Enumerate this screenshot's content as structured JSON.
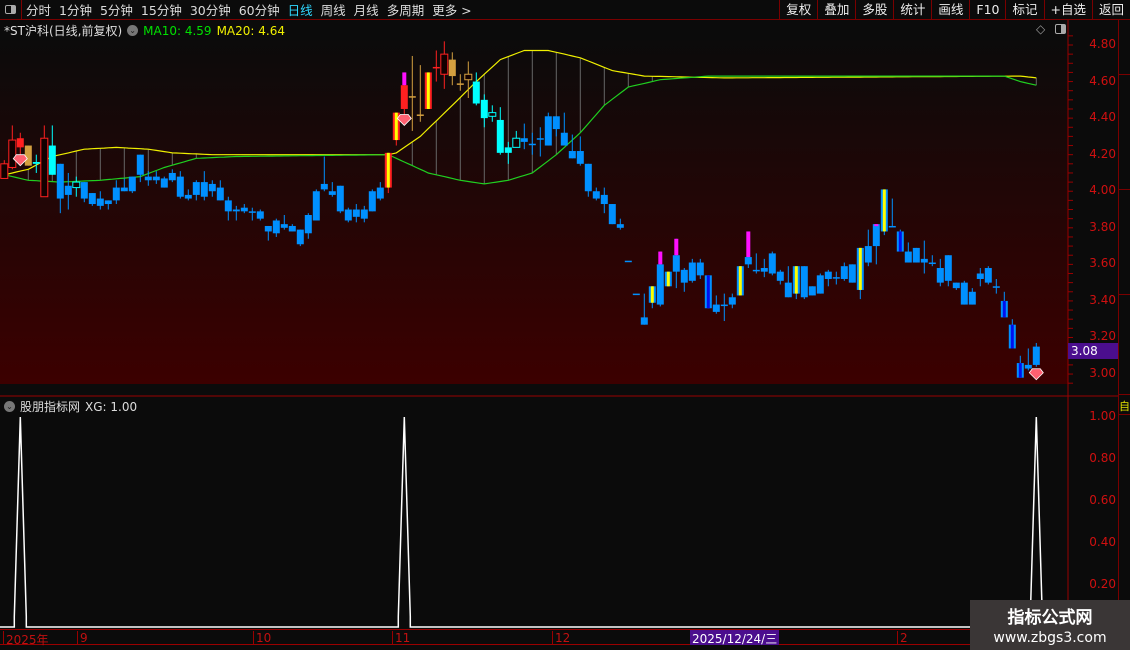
{
  "toolbar": {
    "periods": [
      "分时",
      "1分钟",
      "5分钟",
      "15分钟",
      "30分钟",
      "60分钟",
      "日线",
      "周线",
      "月线",
      "多周期",
      "更多 >"
    ],
    "active": "日线",
    "right_buttons": [
      "复权",
      "叠加",
      "多股",
      "统计",
      "画线",
      "F10",
      "标记",
      "+自选",
      "返回"
    ]
  },
  "title": {
    "stock": "*ST沪科(日线,前复权)",
    "ma10": "MA10: 4.59",
    "ma20": "MA20: 4.64",
    "ma10_color": "#00e000",
    "ma20_color": "#f0f000"
  },
  "price_axis": [
    "4.80",
    "4.60",
    "4.40",
    "4.20",
    "4.00",
    "3.80",
    "3.60",
    "3.40",
    "3.20",
    "3.00"
  ],
  "current_price": "3.08",
  "indicator": {
    "name": "股朋指标网",
    "value": "XG: 1.00",
    "axis": [
      "1.00",
      "0.80",
      "0.60",
      "0.40",
      "0.20"
    ],
    "signal_bars": [
      2,
      50,
      129
    ]
  },
  "time_axis": {
    "labels": [
      "2025年",
      "9",
      "10",
      "11",
      "12",
      "2"
    ],
    "highlight": "2025/12/24/三"
  },
  "right_strip": {
    "label": "自"
  },
  "watermark": {
    "name": "指标公式网",
    "url": "www.zbgs3.com"
  },
  "chart_data": {
    "type": "candlestick",
    "price_range": [
      2.95,
      4.85
    ],
    "candles": [
      [
        4.15,
        4.07,
        4.17,
        4.07,
        "r"
      ],
      [
        4.28,
        4.13,
        4.36,
        4.12,
        "r"
      ],
      [
        4.29,
        4.24,
        4.32,
        4.2,
        "R"
      ],
      [
        4.25,
        4.14,
        4.25,
        4.14,
        "o"
      ],
      [
        4.16,
        4.15,
        4.2,
        4.1,
        "c"
      ],
      [
        4.29,
        3.97,
        4.36,
        3.97,
        "r"
      ],
      [
        4.25,
        4.09,
        4.36,
        4.09,
        "c"
      ],
      [
        4.15,
        3.96,
        4.15,
        3.88,
        "b"
      ],
      [
        4.03,
        3.98,
        4.1,
        3.9,
        "b"
      ],
      [
        4.05,
        4.02,
        4.08,
        3.97,
        "ch"
      ],
      [
        4.05,
        3.96,
        4.05,
        3.94,
        "b"
      ],
      [
        3.99,
        3.93,
        3.99,
        3.92,
        "b"
      ],
      [
        3.96,
        3.92,
        4,
        3.9,
        "b"
      ],
      [
        3.95,
        3.93,
        3.95,
        3.9,
        "b"
      ],
      [
        4.02,
        3.95,
        4.06,
        3.93,
        "b"
      ],
      [
        4.02,
        4,
        4.07,
        4,
        "b"
      ],
      [
        4.08,
        4,
        4.08,
        3.99,
        "b"
      ],
      [
        4.2,
        4.09,
        4.2,
        4.05,
        "b"
      ],
      [
        4.08,
        4.06,
        4.11,
        4.03,
        "b"
      ],
      [
        4.08,
        4.06,
        4.11,
        4.04,
        "b"
      ],
      [
        4.07,
        4.02,
        4.08,
        4.02,
        "b"
      ],
      [
        4.1,
        4.06,
        4.12,
        4.05,
        "b"
      ],
      [
        4.08,
        3.97,
        4.11,
        3.96,
        "b"
      ],
      [
        3.98,
        3.96,
        4.01,
        3.95,
        "b"
      ],
      [
        4.05,
        3.98,
        4.06,
        3.95,
        "b"
      ],
      [
        4.05,
        3.97,
        4.11,
        3.95,
        "b"
      ],
      [
        4.04,
        4,
        4.06,
        3.97,
        "b"
      ],
      [
        4.02,
        3.95,
        4.06,
        3.95,
        "b"
      ],
      [
        3.95,
        3.89,
        3.97,
        3.84,
        "b"
      ],
      [
        3.9,
        3.89,
        3.92,
        3.84,
        "b"
      ],
      [
        3.91,
        3.89,
        3.93,
        3.88,
        "b"
      ],
      [
        3.89,
        3.89,
        3.91,
        3.84,
        "b"
      ],
      [
        3.89,
        3.85,
        3.9,
        3.84,
        "b"
      ],
      [
        3.81,
        3.78,
        3.81,
        3.73,
        "b"
      ],
      [
        3.84,
        3.77,
        3.85,
        3.75,
        "b"
      ],
      [
        3.82,
        3.8,
        3.87,
        3.79,
        "b"
      ],
      [
        3.81,
        3.78,
        3.82,
        3.78,
        "b"
      ],
      [
        3.79,
        3.71,
        3.79,
        3.7,
        "b"
      ],
      [
        3.87,
        3.77,
        3.88,
        3.74,
        "b"
      ],
      [
        4,
        3.84,
        4.01,
        3.84,
        "b"
      ],
      [
        4.04,
        4.01,
        4.19,
        4,
        "b"
      ],
      [
        4,
        3.98,
        4.05,
        3.97,
        "b"
      ],
      [
        4.03,
        3.89,
        4.03,
        3.88,
        "b"
      ],
      [
        3.9,
        3.84,
        3.91,
        3.83,
        "b"
      ],
      [
        3.9,
        3.86,
        3.93,
        3.83,
        "b"
      ],
      [
        3.9,
        3.85,
        3.92,
        3.83,
        "b"
      ],
      [
        4,
        3.89,
        4.01,
        3.89,
        "b"
      ],
      [
        4.02,
        3.96,
        4.05,
        3.95,
        "b"
      ],
      [
        4.21,
        4.02,
        4.21,
        3.99,
        "yr"
      ],
      [
        4.43,
        4.28,
        4.43,
        4.25,
        "yr"
      ],
      [
        4.58,
        4.45,
        4.65,
        4.42,
        "rm"
      ],
      [
        4.52,
        4.52,
        4.74,
        4.33,
        "o"
      ],
      [
        4.42,
        4.42,
        4.69,
        4.38,
        "o"
      ],
      [
        4.65,
        4.45,
        4.65,
        4.45,
        "yr"
      ],
      [
        4.68,
        4.68,
        4.77,
        4.6,
        "R"
      ],
      [
        4.75,
        4.64,
        4.82,
        4.56,
        "r"
      ],
      [
        4.72,
        4.63,
        4.76,
        4.58,
        "o"
      ],
      [
        4.59,
        4.59,
        4.64,
        4.55,
        "o"
      ],
      [
        4.64,
        4.61,
        4.71,
        4.51,
        "oh"
      ],
      [
        4.6,
        4.48,
        4.65,
        4.47,
        "c"
      ],
      [
        4.5,
        4.4,
        4.53,
        4.35,
        "c"
      ],
      [
        4.43,
        4.41,
        4.47,
        4.38,
        "ch"
      ],
      [
        4.39,
        4.21,
        4.46,
        4.2,
        "c"
      ],
      [
        4.24,
        4.21,
        4.27,
        4.15,
        "c"
      ],
      [
        4.29,
        4.24,
        4.33,
        4.24,
        "ch"
      ],
      [
        4.29,
        4.27,
        4.37,
        4.23,
        "b"
      ],
      [
        4.26,
        4.26,
        4.32,
        4.2,
        "b"
      ],
      [
        4.29,
        4.29,
        4.35,
        4.19,
        "b"
      ],
      [
        4.41,
        4.25,
        4.43,
        4.25,
        "b"
      ],
      [
        4.41,
        4.34,
        4.41,
        4.3,
        "b"
      ],
      [
        4.32,
        4.25,
        4.43,
        4.25,
        "b"
      ],
      [
        4.22,
        4.18,
        4.31,
        4.18,
        "b"
      ],
      [
        4.22,
        4.15,
        4.3,
        4.14,
        "b"
      ],
      [
        4.15,
        4,
        4.15,
        3.97,
        "b"
      ],
      [
        4,
        3.96,
        4.02,
        3.95,
        "b"
      ],
      [
        3.98,
        3.93,
        4.02,
        3.88,
        "b"
      ],
      [
        3.93,
        3.82,
        3.93,
        3.82,
        "b"
      ],
      [
        3.82,
        3.8,
        3.85,
        3.79,
        "b"
      ],
      [
        3.62,
        3.62,
        3.62,
        3.62,
        "b"
      ],
      [
        3.44,
        3.44,
        3.44,
        3.44,
        "b"
      ],
      [
        3.31,
        3.27,
        3.44,
        3.27,
        "b"
      ],
      [
        3.48,
        3.39,
        3.48,
        3.36,
        "y"
      ],
      [
        3.6,
        3.38,
        3.67,
        3.37,
        "bm"
      ],
      [
        3.56,
        3.48,
        3.56,
        3.48,
        "y"
      ],
      [
        3.65,
        3.56,
        3.74,
        3.47,
        "bm"
      ],
      [
        3.57,
        3.5,
        3.58,
        3.45,
        "b"
      ],
      [
        3.61,
        3.51,
        3.63,
        3.5,
        "b"
      ],
      [
        3.61,
        3.54,
        3.63,
        3.52,
        "b"
      ],
      [
        3.54,
        3.36,
        3.54,
        3.36,
        "db"
      ],
      [
        3.38,
        3.34,
        3.43,
        3.33,
        "b"
      ],
      [
        3.38,
        3.38,
        3.44,
        3.29,
        "b"
      ],
      [
        3.42,
        3.38,
        3.44,
        3.36,
        "b"
      ],
      [
        3.59,
        3.43,
        3.59,
        3.43,
        "y"
      ],
      [
        3.64,
        3.6,
        3.78,
        3.58,
        "bm"
      ],
      [
        3.57,
        3.57,
        3.66,
        3.55,
        "b"
      ],
      [
        3.58,
        3.56,
        3.63,
        3.53,
        "b"
      ],
      [
        3.66,
        3.55,
        3.67,
        3.54,
        "b"
      ],
      [
        3.56,
        3.51,
        3.57,
        3.49,
        "b"
      ],
      [
        3.5,
        3.42,
        3.59,
        3.42,
        "b"
      ],
      [
        3.59,
        3.44,
        3.59,
        3.41,
        "y"
      ],
      [
        3.59,
        3.42,
        3.59,
        3.41,
        "b"
      ],
      [
        3.48,
        3.43,
        3.48,
        3.43,
        "b"
      ],
      [
        3.54,
        3.44,
        3.55,
        3.44,
        "b"
      ],
      [
        3.56,
        3.52,
        3.57,
        3.48,
        "b"
      ],
      [
        3.53,
        3.53,
        3.56,
        3.49,
        "b"
      ],
      [
        3.59,
        3.52,
        3.61,
        3.51,
        "b"
      ],
      [
        3.6,
        3.5,
        3.6,
        3.5,
        "b"
      ],
      [
        3.69,
        3.46,
        3.69,
        3.41,
        "y"
      ],
      [
        3.7,
        3.61,
        3.79,
        3.59,
        "b"
      ],
      [
        3.82,
        3.7,
        3.82,
        3.6,
        "bm"
      ],
      [
        4.01,
        3.78,
        4.01,
        3.76,
        "y"
      ],
      [
        3.81,
        3.81,
        3.96,
        3.81,
        "b"
      ],
      [
        3.78,
        3.67,
        3.79,
        3.67,
        "db"
      ],
      [
        3.67,
        3.61,
        3.72,
        3.61,
        "b"
      ],
      [
        3.69,
        3.61,
        3.69,
        3.61,
        "b"
      ],
      [
        3.63,
        3.61,
        3.73,
        3.55,
        "b"
      ],
      [
        3.61,
        3.61,
        3.65,
        3.59,
        "b"
      ],
      [
        3.58,
        3.5,
        3.63,
        3.48,
        "b"
      ],
      [
        3.65,
        3.51,
        3.65,
        3.48,
        "b"
      ],
      [
        3.5,
        3.47,
        3.5,
        3.46,
        "b"
      ],
      [
        3.5,
        3.38,
        3.51,
        3.38,
        "b"
      ],
      [
        3.45,
        3.38,
        3.47,
        3.38,
        "b"
      ],
      [
        3.55,
        3.52,
        3.58,
        3.48,
        "b"
      ],
      [
        3.58,
        3.5,
        3.59,
        3.49,
        "b"
      ],
      [
        3.48,
        3.48,
        3.52,
        3.44,
        "b"
      ],
      [
        3.4,
        3.31,
        3.45,
        3.31,
        "db"
      ],
      [
        3.27,
        3.14,
        3.3,
        3.14,
        "db"
      ],
      [
        3.06,
        2.98,
        3.1,
        2.98,
        "db"
      ],
      [
        3.05,
        3.03,
        3.14,
        3.02,
        "b"
      ],
      [
        3.15,
        3.05,
        3.17,
        3.04,
        "b"
      ]
    ],
    "ma_yellow": [
      [
        0,
        4.09
      ],
      [
        3,
        4.12
      ],
      [
        6,
        4.19
      ],
      [
        10,
        4.23
      ],
      [
        14,
        4.24
      ],
      [
        18,
        4.23
      ],
      [
        21,
        4.21
      ],
      [
        26,
        4.2
      ],
      [
        48,
        4.2
      ],
      [
        49,
        4.21
      ],
      [
        52,
        4.3
      ],
      [
        56,
        4.47
      ],
      [
        59,
        4.6
      ],
      [
        62,
        4.72
      ],
      [
        65,
        4.77
      ],
      [
        68,
        4.77
      ],
      [
        72,
        4.73
      ],
      [
        76,
        4.66
      ],
      [
        80,
        4.63
      ],
      [
        90,
        4.62
      ],
      [
        127,
        4.63
      ],
      [
        129,
        4.62
      ]
    ],
    "ma_green": [
      [
        0,
        4.09
      ],
      [
        3,
        4.06
      ],
      [
        7,
        4.05
      ],
      [
        12,
        4.06
      ],
      [
        17,
        4.08
      ],
      [
        20,
        4.13
      ],
      [
        24,
        4.18
      ],
      [
        29,
        4.19
      ],
      [
        48,
        4.2
      ],
      [
        50,
        4.16
      ],
      [
        53,
        4.1
      ],
      [
        57,
        4.06
      ],
      [
        60,
        4.04
      ],
      [
        63,
        4.06
      ],
      [
        66,
        4.1
      ],
      [
        69,
        4.2
      ],
      [
        72,
        4.32
      ],
      [
        75,
        4.47
      ],
      [
        78,
        4.57
      ],
      [
        82,
        4.61
      ],
      [
        88,
        4.63
      ],
      [
        125,
        4.63
      ],
      [
        127,
        4.6
      ],
      [
        129,
        4.58
      ]
    ],
    "gem_markers": [
      2,
      50,
      129
    ]
  }
}
